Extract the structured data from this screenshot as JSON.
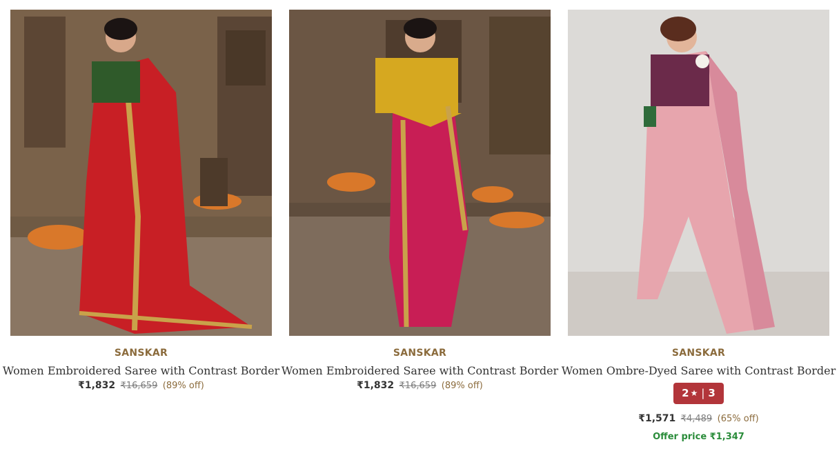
{
  "products": [
    {
      "brand": "SANSKAR",
      "name": "Women Embroidered Saree with Contrast Border",
      "price": "₹1,832",
      "mrp": "₹16,659",
      "discount": "(89% off)"
    },
    {
      "brand": "SANSKAR",
      "name": "Women Embroidered Saree with Contrast Border",
      "price": "₹1,832",
      "mrp": "₹16,659",
      "discount": "(89% off)"
    },
    {
      "brand": "SANSKAR",
      "name": "Women Ombre-Dyed Saree with Contrast Border",
      "rating": "2",
      "rating_count": "3",
      "price": "₹1,571",
      "mrp": "₹4,489",
      "discount": "(65% off)",
      "offer_price": "Offer price ₹1,347"
    }
  ],
  "icons": {
    "rating_star": "★",
    "rating_separator": "|"
  },
  "colors": {
    "brand": "#8b6b3c",
    "rating_badge": "#b2353a",
    "offer": "#2a8c3a"
  }
}
